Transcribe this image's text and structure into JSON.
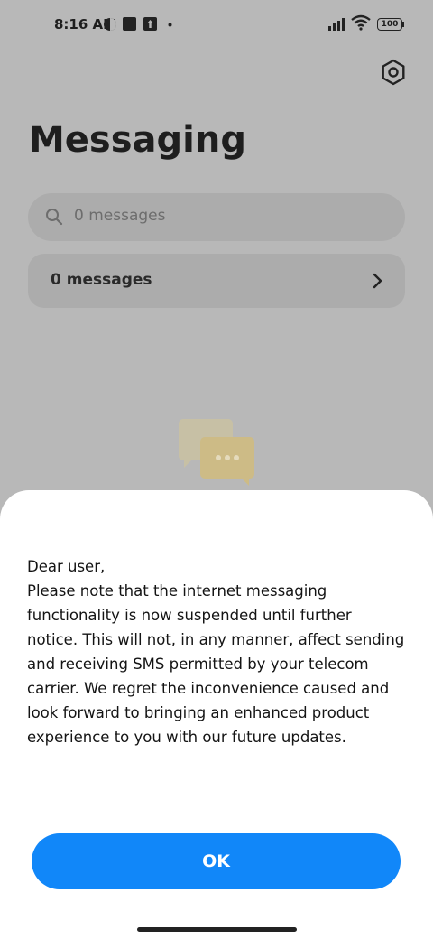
{
  "status_bar": {
    "time": "8:16 AM",
    "battery": "100"
  },
  "header": {
    "title": "Messaging",
    "settings_icon": "settings-icon"
  },
  "search": {
    "placeholder": "0 messages"
  },
  "list": {
    "row_label": "0 messages"
  },
  "dialog": {
    "greeting": "Dear user,",
    "body": "Please note that the internet messaging functionality is now suspended until further notice. This will not, in any manner, affect sending and receiving SMS permitted by your telecom carrier. We regret the inconvenience caused and look forward to bringing an enhanced product experience to you with our future updates.",
    "ok_label": "OK"
  },
  "colors": {
    "accent": "#1187f9",
    "background_dim": "#b8b8b8",
    "sheet": "#ffffff"
  }
}
